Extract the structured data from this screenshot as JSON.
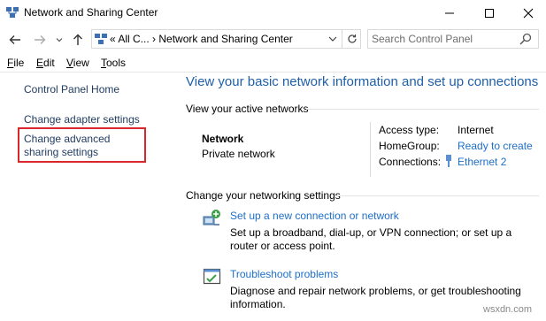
{
  "window": {
    "title": "Network and Sharing Center",
    "controls": {
      "minimize": "—",
      "maximize": "☐",
      "close": "✕"
    }
  },
  "nav": {
    "back": "←",
    "forward": "→",
    "recent": "˅",
    "up": "↑",
    "address": "« All C... › Network and Sharing Center",
    "address_dropdown": "˅",
    "refresh": "↻",
    "search_placeholder": "Search Control Panel"
  },
  "menu": {
    "file": {
      "key": "F",
      "rest": "ile"
    },
    "edit": {
      "key": "E",
      "rest": "dit"
    },
    "view": {
      "key": "V",
      "rest": "iew"
    },
    "tools": {
      "key": "T",
      "rest": "ools"
    }
  },
  "sidebar": {
    "home": "Control Panel Home",
    "adapter": "Change adapter settings",
    "advanced": "Change advanced sharing settings"
  },
  "main": {
    "heading": "View your basic network information and set up connections",
    "active_networks_label": "View your active networks",
    "network": {
      "name": "Network",
      "type": "Private network",
      "access_type_label": "Access type:",
      "access_type_value": "Internet",
      "homegroup_label": "HomeGroup:",
      "homegroup_value": "Ready to create",
      "connections_label": "Connections:",
      "connections_value": "Ethernet 2"
    },
    "change_settings_label": "Change your networking settings",
    "tasks": [
      {
        "title": "Set up a new connection or network",
        "description": "Set up a broadband, dial-up, or VPN connection; or set up a router or access point.",
        "icon": "new-connection-icon"
      },
      {
        "title": "Troubleshoot problems",
        "description": "Diagnose and repair network problems, or get troubleshooting information.",
        "icon": "troubleshoot-icon"
      }
    ]
  },
  "watermark": "wsxdn.com",
  "colors": {
    "link": "#1e6fc8",
    "heading": "#1e5fa8",
    "highlight": "#d9262b"
  }
}
